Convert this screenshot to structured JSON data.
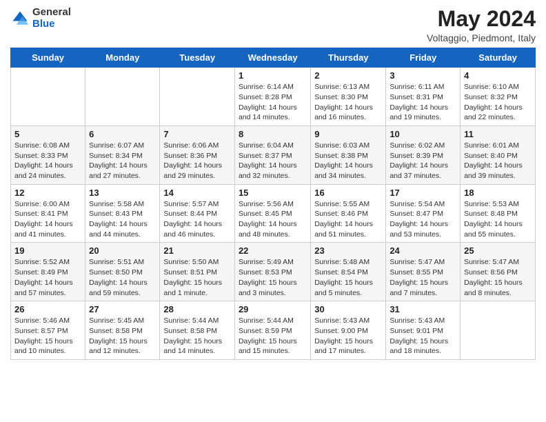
{
  "header": {
    "logo_general": "General",
    "logo_blue": "Blue",
    "month_title": "May 2024",
    "location": "Voltaggio, Piedmont, Italy"
  },
  "days_of_week": [
    "Sunday",
    "Monday",
    "Tuesday",
    "Wednesday",
    "Thursday",
    "Friday",
    "Saturday"
  ],
  "weeks": [
    [
      {
        "day": "",
        "sunrise": "",
        "sunset": "",
        "daylight": ""
      },
      {
        "day": "",
        "sunrise": "",
        "sunset": "",
        "daylight": ""
      },
      {
        "day": "",
        "sunrise": "",
        "sunset": "",
        "daylight": ""
      },
      {
        "day": "1",
        "sunrise": "Sunrise: 6:14 AM",
        "sunset": "Sunset: 8:28 PM",
        "daylight": "Daylight: 14 hours and 14 minutes."
      },
      {
        "day": "2",
        "sunrise": "Sunrise: 6:13 AM",
        "sunset": "Sunset: 8:30 PM",
        "daylight": "Daylight: 14 hours and 16 minutes."
      },
      {
        "day": "3",
        "sunrise": "Sunrise: 6:11 AM",
        "sunset": "Sunset: 8:31 PM",
        "daylight": "Daylight: 14 hours and 19 minutes."
      },
      {
        "day": "4",
        "sunrise": "Sunrise: 6:10 AM",
        "sunset": "Sunset: 8:32 PM",
        "daylight": "Daylight: 14 hours and 22 minutes."
      }
    ],
    [
      {
        "day": "5",
        "sunrise": "Sunrise: 6:08 AM",
        "sunset": "Sunset: 8:33 PM",
        "daylight": "Daylight: 14 hours and 24 minutes."
      },
      {
        "day": "6",
        "sunrise": "Sunrise: 6:07 AM",
        "sunset": "Sunset: 8:34 PM",
        "daylight": "Daylight: 14 hours and 27 minutes."
      },
      {
        "day": "7",
        "sunrise": "Sunrise: 6:06 AM",
        "sunset": "Sunset: 8:36 PM",
        "daylight": "Daylight: 14 hours and 29 minutes."
      },
      {
        "day": "8",
        "sunrise": "Sunrise: 6:04 AM",
        "sunset": "Sunset: 8:37 PM",
        "daylight": "Daylight: 14 hours and 32 minutes."
      },
      {
        "day": "9",
        "sunrise": "Sunrise: 6:03 AM",
        "sunset": "Sunset: 8:38 PM",
        "daylight": "Daylight: 14 hours and 34 minutes."
      },
      {
        "day": "10",
        "sunrise": "Sunrise: 6:02 AM",
        "sunset": "Sunset: 8:39 PM",
        "daylight": "Daylight: 14 hours and 37 minutes."
      },
      {
        "day": "11",
        "sunrise": "Sunrise: 6:01 AM",
        "sunset": "Sunset: 8:40 PM",
        "daylight": "Daylight: 14 hours and 39 minutes."
      }
    ],
    [
      {
        "day": "12",
        "sunrise": "Sunrise: 6:00 AM",
        "sunset": "Sunset: 8:41 PM",
        "daylight": "Daylight: 14 hours and 41 minutes."
      },
      {
        "day": "13",
        "sunrise": "Sunrise: 5:58 AM",
        "sunset": "Sunset: 8:43 PM",
        "daylight": "Daylight: 14 hours and 44 minutes."
      },
      {
        "day": "14",
        "sunrise": "Sunrise: 5:57 AM",
        "sunset": "Sunset: 8:44 PM",
        "daylight": "Daylight: 14 hours and 46 minutes."
      },
      {
        "day": "15",
        "sunrise": "Sunrise: 5:56 AM",
        "sunset": "Sunset: 8:45 PM",
        "daylight": "Daylight: 14 hours and 48 minutes."
      },
      {
        "day": "16",
        "sunrise": "Sunrise: 5:55 AM",
        "sunset": "Sunset: 8:46 PM",
        "daylight": "Daylight: 14 hours and 51 minutes."
      },
      {
        "day": "17",
        "sunrise": "Sunrise: 5:54 AM",
        "sunset": "Sunset: 8:47 PM",
        "daylight": "Daylight: 14 hours and 53 minutes."
      },
      {
        "day": "18",
        "sunrise": "Sunrise: 5:53 AM",
        "sunset": "Sunset: 8:48 PM",
        "daylight": "Daylight: 14 hours and 55 minutes."
      }
    ],
    [
      {
        "day": "19",
        "sunrise": "Sunrise: 5:52 AM",
        "sunset": "Sunset: 8:49 PM",
        "daylight": "Daylight: 14 hours and 57 minutes."
      },
      {
        "day": "20",
        "sunrise": "Sunrise: 5:51 AM",
        "sunset": "Sunset: 8:50 PM",
        "daylight": "Daylight: 14 hours and 59 minutes."
      },
      {
        "day": "21",
        "sunrise": "Sunrise: 5:50 AM",
        "sunset": "Sunset: 8:51 PM",
        "daylight": "Daylight: 15 hours and 1 minute."
      },
      {
        "day": "22",
        "sunrise": "Sunrise: 5:49 AM",
        "sunset": "Sunset: 8:53 PM",
        "daylight": "Daylight: 15 hours and 3 minutes."
      },
      {
        "day": "23",
        "sunrise": "Sunrise: 5:48 AM",
        "sunset": "Sunset: 8:54 PM",
        "daylight": "Daylight: 15 hours and 5 minutes."
      },
      {
        "day": "24",
        "sunrise": "Sunrise: 5:47 AM",
        "sunset": "Sunset: 8:55 PM",
        "daylight": "Daylight: 15 hours and 7 minutes."
      },
      {
        "day": "25",
        "sunrise": "Sunrise: 5:47 AM",
        "sunset": "Sunset: 8:56 PM",
        "daylight": "Daylight: 15 hours and 8 minutes."
      }
    ],
    [
      {
        "day": "26",
        "sunrise": "Sunrise: 5:46 AM",
        "sunset": "Sunset: 8:57 PM",
        "daylight": "Daylight: 15 hours and 10 minutes."
      },
      {
        "day": "27",
        "sunrise": "Sunrise: 5:45 AM",
        "sunset": "Sunset: 8:58 PM",
        "daylight": "Daylight: 15 hours and 12 minutes."
      },
      {
        "day": "28",
        "sunrise": "Sunrise: 5:44 AM",
        "sunset": "Sunset: 8:58 PM",
        "daylight": "Daylight: 15 hours and 14 minutes."
      },
      {
        "day": "29",
        "sunrise": "Sunrise: 5:44 AM",
        "sunset": "Sunset: 8:59 PM",
        "daylight": "Daylight: 15 hours and 15 minutes."
      },
      {
        "day": "30",
        "sunrise": "Sunrise: 5:43 AM",
        "sunset": "Sunset: 9:00 PM",
        "daylight": "Daylight: 15 hours and 17 minutes."
      },
      {
        "day": "31",
        "sunrise": "Sunrise: 5:43 AM",
        "sunset": "Sunset: 9:01 PM",
        "daylight": "Daylight: 15 hours and 18 minutes."
      },
      {
        "day": "",
        "sunrise": "",
        "sunset": "",
        "daylight": ""
      }
    ]
  ]
}
